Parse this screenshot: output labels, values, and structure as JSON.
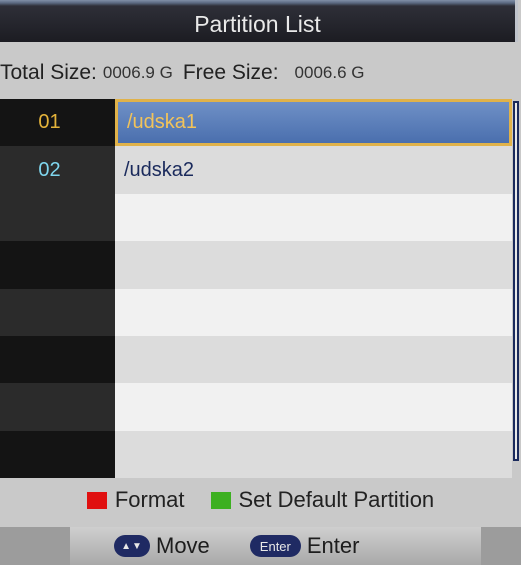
{
  "title": "Partition List",
  "sizes": {
    "total_label": "Total Size:",
    "total_value": "0006.9 G",
    "free_label": "Free Size:",
    "free_value": "0006.6 G"
  },
  "partitions": [
    {
      "num": "01",
      "name": "/udska1"
    },
    {
      "num": "02",
      "name": "/udska2"
    }
  ],
  "legend": {
    "format_label": "Format",
    "format_color": "#e01010",
    "default_label": "Set Default Partition",
    "default_color": "#3db021"
  },
  "footer": {
    "move_icon": "up-down-arrows-icon",
    "move_label": "Move",
    "enter_key": "Enter",
    "enter_label": "Enter"
  }
}
